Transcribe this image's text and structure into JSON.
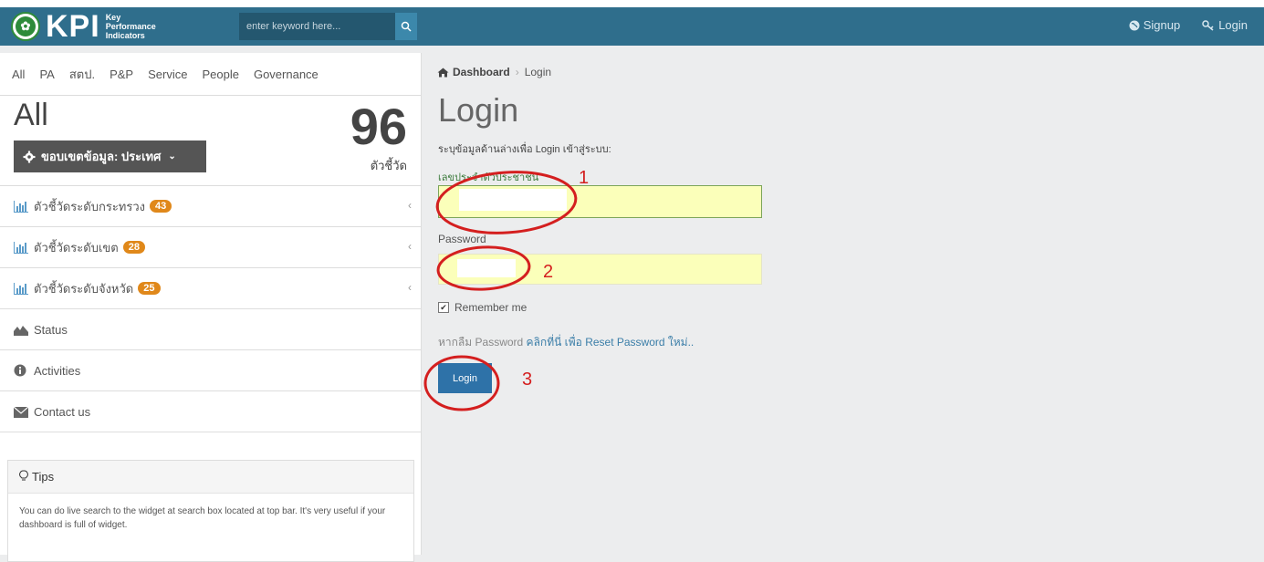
{
  "topbar": {
    "logo_text": "KPI",
    "logo_sub": "Key Performance Indicators",
    "search_placeholder": "enter keyword here...",
    "signup_label": "Signup",
    "login_label": "Login",
    "accent_color": "#2f6e8c"
  },
  "sidebar": {
    "tabs": [
      "All",
      "PA",
      "สตป.",
      "P&P",
      "Service",
      "People",
      "Governance"
    ],
    "summary": {
      "heading": "All",
      "scope_label": "ขอบเขตข้อมูล: ประเทศ",
      "count": "96",
      "count_label": "ตัวชี้วัด"
    },
    "items": [
      {
        "label": "ตัวชี้วัดระดับกระทรวง",
        "badge": "43",
        "icon": "bar-chart-icon"
      },
      {
        "label": "ตัวชี้วัดระดับเขต",
        "badge": "28",
        "icon": "bar-chart-icon"
      },
      {
        "label": "ตัวชี้วัดระดับจังหวัด",
        "badge": "25",
        "icon": "bar-chart-icon"
      },
      {
        "label": "Status",
        "icon": "area-chart-icon"
      },
      {
        "label": "Activities",
        "icon": "info-circle-icon"
      },
      {
        "label": "Contact us",
        "icon": "envelope-icon"
      }
    ],
    "tips": {
      "title": "Tips",
      "body": "You can do live search to the widget at search box located at top bar. It's very useful if your dashboard is full of widget."
    }
  },
  "main": {
    "breadcrumb": {
      "home": "Dashboard",
      "current": "Login"
    },
    "title": "Login",
    "hint": "ระบุข้อมูลด้านล่างเพื่อ Login เข้าสู่ระบบ:",
    "id_label": "เลขประจำตัวประชาชน",
    "password_label": "Password",
    "remember_label": "Remember me",
    "forgot_prefix": "หากลืม Password",
    "forgot_link": "คลิกที่นี่ เพื่อ Reset Password ใหม่..",
    "login_button": "Login"
  },
  "annotations": [
    "1",
    "2",
    "3"
  ]
}
